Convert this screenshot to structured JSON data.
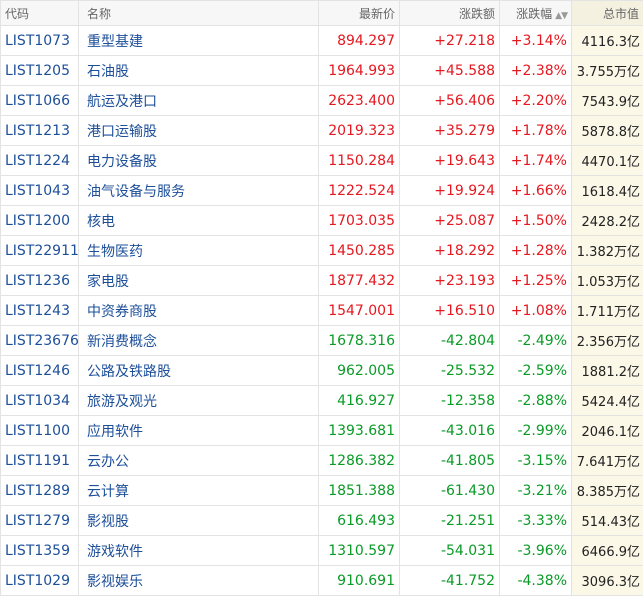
{
  "headers": {
    "code": "代码",
    "name": "名称",
    "price": "最新价",
    "change": "涨跌额",
    "pct": "涨跌幅",
    "cap": "总市值"
  },
  "rows": [
    {
      "code": "LIST1073",
      "name": "重型基建",
      "price": "894.297",
      "change": "+27.218",
      "pct": "+3.14%",
      "cap": "4116.3亿",
      "dir": "up"
    },
    {
      "code": "LIST1205",
      "name": "石油股",
      "price": "1964.993",
      "change": "+45.588",
      "pct": "+2.38%",
      "cap": "3.755万亿",
      "dir": "up"
    },
    {
      "code": "LIST1066",
      "name": "航运及港口",
      "price": "2623.400",
      "change": "+56.406",
      "pct": "+2.20%",
      "cap": "7543.9亿",
      "dir": "up"
    },
    {
      "code": "LIST1213",
      "name": "港口运输股",
      "price": "2019.323",
      "change": "+35.279",
      "pct": "+1.78%",
      "cap": "5878.8亿",
      "dir": "up"
    },
    {
      "code": "LIST1224",
      "name": "电力设备股",
      "price": "1150.284",
      "change": "+19.643",
      "pct": "+1.74%",
      "cap": "4470.1亿",
      "dir": "up"
    },
    {
      "code": "LIST1043",
      "name": "油气设备与服务",
      "price": "1222.524",
      "change": "+19.924",
      "pct": "+1.66%",
      "cap": "1618.4亿",
      "dir": "up"
    },
    {
      "code": "LIST1200",
      "name": "核电",
      "price": "1703.035",
      "change": "+25.087",
      "pct": "+1.50%",
      "cap": "2428.2亿",
      "dir": "up"
    },
    {
      "code": "LIST22911",
      "name": "生物医药",
      "price": "1450.285",
      "change": "+18.292",
      "pct": "+1.28%",
      "cap": "1.382万亿",
      "dir": "up"
    },
    {
      "code": "LIST1236",
      "name": "家电股",
      "price": "1877.432",
      "change": "+23.193",
      "pct": "+1.25%",
      "cap": "1.053万亿",
      "dir": "up"
    },
    {
      "code": "LIST1243",
      "name": "中资券商股",
      "price": "1547.001",
      "change": "+16.510",
      "pct": "+1.08%",
      "cap": "1.711万亿",
      "dir": "up"
    },
    {
      "code": "LIST23676",
      "name": "新消费概念",
      "price": "1678.316",
      "change": "-42.804",
      "pct": "-2.49%",
      "cap": "2.356万亿",
      "dir": "down"
    },
    {
      "code": "LIST1246",
      "name": "公路及铁路股",
      "price": "962.005",
      "change": "-25.532",
      "pct": "-2.59%",
      "cap": "1881.2亿",
      "dir": "down"
    },
    {
      "code": "LIST1034",
      "name": "旅游及观光",
      "price": "416.927",
      "change": "-12.358",
      "pct": "-2.88%",
      "cap": "5424.4亿",
      "dir": "down"
    },
    {
      "code": "LIST1100",
      "name": "应用软件",
      "price": "1393.681",
      "change": "-43.016",
      "pct": "-2.99%",
      "cap": "2046.1亿",
      "dir": "down"
    },
    {
      "code": "LIST1191",
      "name": "云办公",
      "price": "1286.382",
      "change": "-41.805",
      "pct": "-3.15%",
      "cap": "7.641万亿",
      "dir": "down"
    },
    {
      "code": "LIST1289",
      "name": "云计算",
      "price": "1851.388",
      "change": "-61.430",
      "pct": "-3.21%",
      "cap": "8.385万亿",
      "dir": "down"
    },
    {
      "code": "LIST1279",
      "name": "影视股",
      "price": "616.493",
      "change": "-21.251",
      "pct": "-3.33%",
      "cap": "514.43亿",
      "dir": "down"
    },
    {
      "code": "LIST1359",
      "name": "游戏软件",
      "price": "1310.597",
      "change": "-54.031",
      "pct": "-3.96%",
      "cap": "6466.9亿",
      "dir": "down"
    },
    {
      "code": "LIST1029",
      "name": "影视娱乐",
      "price": "910.691",
      "change": "-41.752",
      "pct": "-4.38%",
      "cap": "3096.3亿",
      "dir": "down"
    }
  ],
  "colors": {
    "up": "#e5171f",
    "down": "#0a9a26",
    "link": "#1d4f99"
  },
  "icons": {
    "sort": "sort-icon"
  }
}
